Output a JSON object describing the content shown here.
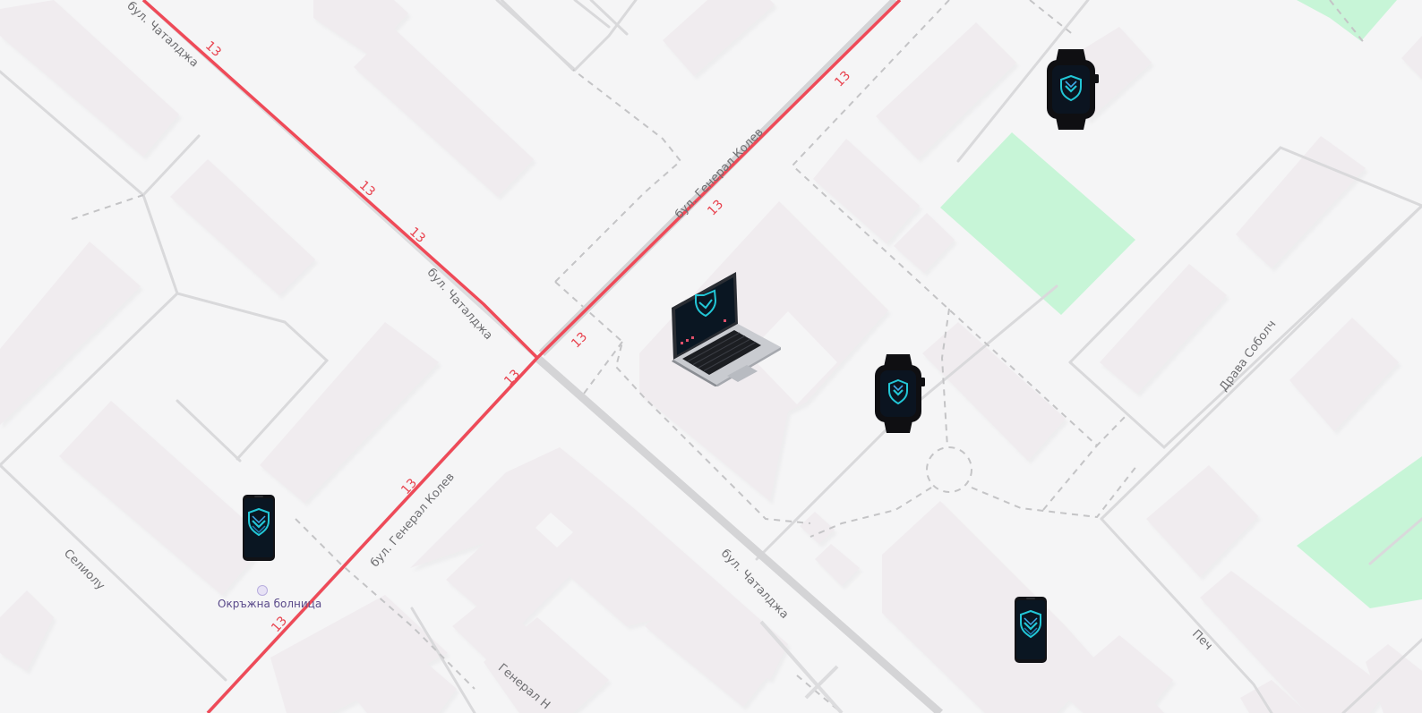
{
  "map": {
    "streets": {
      "chataldzha": "бул. Чаталджа",
      "general_kolev": "бул. Генерал Колев",
      "drava_sobolch": "Драва Соболч",
      "selioglu": "Селиолу",
      "pech": "Печ",
      "general_n": "Генерал Н"
    },
    "route_number": "13",
    "poi": {
      "hospital": "Окръжна болница"
    }
  },
  "markers": [
    {
      "type": "smartwatch",
      "icon": "smartwatch-icon"
    },
    {
      "type": "laptop",
      "icon": "laptop-icon"
    },
    {
      "type": "smartwatch",
      "icon": "smartwatch-icon"
    },
    {
      "type": "smartphone",
      "icon": "smartphone-icon"
    },
    {
      "type": "smartphone",
      "icon": "smartphone-icon"
    }
  ],
  "colors": {
    "background": "#f5f5f6",
    "building": "#f0ecef",
    "park": "#c7f5d7",
    "road": "#d6d6d8",
    "route": "#ef4a58",
    "device_screen_accent": "#22c6d6"
  }
}
